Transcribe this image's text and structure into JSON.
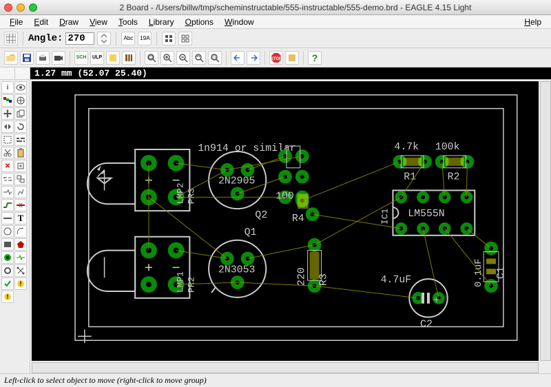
{
  "window": {
    "title": "2 Board - /Users/billw/tmp/scheminstructable/555-instructable/555-demo.brd - EAGLE 4.15 Light"
  },
  "menu": {
    "file": "File",
    "edit": "Edit",
    "draw": "Draw",
    "view": "View",
    "tools": "Tools",
    "library": "Library",
    "options": "Options",
    "window": "Window",
    "help": "Help"
  },
  "toolbar": {
    "angle_label": "Angle:",
    "angle_value": "270"
  },
  "coords": {
    "text": "1.27 mm (52.07 25.40)"
  },
  "status": {
    "text": "Left-click to select object to move (right-click to move group)"
  },
  "pcb": {
    "parts": {
      "r1_label": "R1",
      "r1_val": "4.7k",
      "r2_label": "R2",
      "r2_val": "100k",
      "r3_label": "R3",
      "r3_val": "220",
      "r4_label": "R4",
      "r4_val": "100",
      "c1_label": "C1",
      "c1_val": "0.1uF",
      "c2_label": "C2",
      "c2_val": "4.7uF",
      "ic1_label": "IC1",
      "ic1_val": "LM555N",
      "q1_label": "Q1",
      "q1_val": "2N3053",
      "q2_label": "Q2",
      "q2_val": "2N2905",
      "d_note": "1n914 or similar",
      "lmp1": "LMP1",
      "lmp2": "LMP2",
      "pr2": "PR2",
      "pr3": "PR3"
    }
  }
}
